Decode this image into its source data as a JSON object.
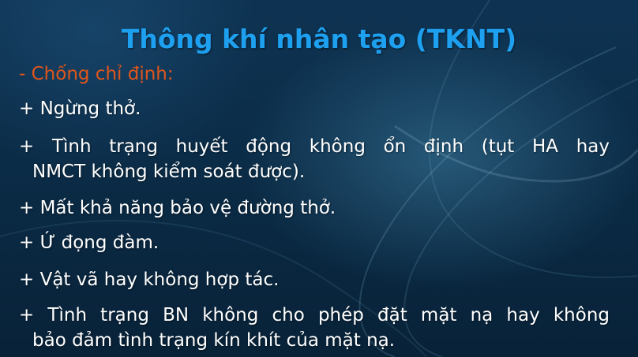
{
  "slide": {
    "title": "Thông khí nhân tạo (TKNT)",
    "subtitle": "- Chống chỉ định:",
    "items": [
      {
        "lines": [
          "+ Ngừng thở."
        ]
      },
      {
        "lines": [
          "+ Tình trạng huyết động không ổn định (tụt HA hay",
          "NMCT không kiểm soát được)."
        ]
      },
      {
        "lines": [
          "+ Mất khả năng bảo vệ đường thở."
        ]
      },
      {
        "lines": [
          "+ Ứ đọng đàm."
        ]
      },
      {
        "lines": [
          "+ Vật vã hay không hợp tác."
        ]
      },
      {
        "lines": [
          "+ Tình trạng BN không cho phép đặt mặt nạ hay không",
          "bảo đảm tình trạng kín khít của mặt nạ."
        ]
      }
    ],
    "colors": {
      "title": "#1ea0f0",
      "subtitle": "#e0561c",
      "body_text": "#ffffff",
      "background": "#0b2a44"
    }
  }
}
